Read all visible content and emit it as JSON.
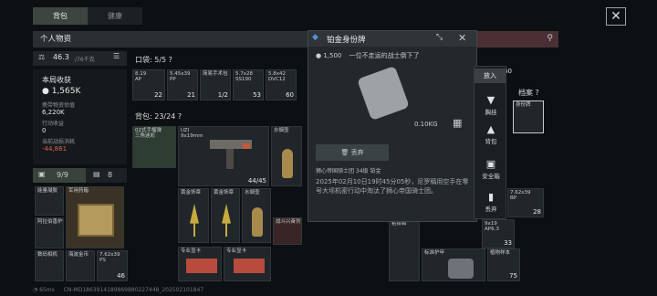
{
  "tabs": [
    "背包",
    "健康"
  ],
  "panel_title": "个人物资",
  "weight": {
    "value": "46.3",
    "max": "/76千克"
  },
  "stats": {
    "round_income_label": "本局收获",
    "round_income": "1,565K",
    "carried_value_label": "携带物资估值",
    "carried_value": "6,220K",
    "action_income_label": "行动收益",
    "action_income": "0",
    "action_cost_label": "当前战损消耗",
    "action_cost": "-44,861"
  },
  "pouch_tabs": {
    "a": "9/9",
    "b": "8"
  },
  "pocket": {
    "label": "口袋: 5/5",
    "items": [
      {
        "name": "8.19\nAP",
        "cnt": "22"
      },
      {
        "name": "5.45x39\nPP",
        "cnt": "21"
      },
      {
        "name": "简易手术包",
        "cnt": "1/2"
      },
      {
        "name": "5.7x28\nSS190",
        "cnt": "53"
      },
      {
        "name": "5.8x42\nDVC12",
        "cnt": "60"
      }
    ]
  },
  "backpack": {
    "label": "背包: 23/24"
  },
  "left_items": [
    {
      "name": "能量凝胶"
    },
    {
      "name": "军用药箱"
    },
    {
      "name": "阿拉伯香炉"
    },
    {
      "name": "数码相机"
    },
    {
      "name": "海波金币"
    },
    {
      "name": "7.62x39\nPS",
      "cnt": "46"
    }
  ],
  "bp_items": [
    {
      "name": "02式手榴弹\n三角迷彩"
    },
    {
      "name": "UZI\n9x19mm",
      "cnt": "44/45"
    },
    {
      "name": "水烟壶"
    },
    {
      "name": "黄金饰章"
    },
    {
      "name": "黄金饰章"
    },
    {
      "name": "水烟壶"
    },
    {
      "name": "战斗兴奋剂"
    },
    {
      "name": "专业显卡"
    },
    {
      "name": "专业显卡"
    }
  ],
  "detail": {
    "title": "铂金身份牌",
    "price": "1,500",
    "flavor": "一位不走运的战士倒下了",
    "weight": "0.10KG",
    "discard": "丢弃",
    "meta": "狮心帝国骑士团  34级  铂金",
    "desc": "2025年02月10日19时45分05秒，尼罗稱用空手在零号大坝机密行动中淘汰了狮心帝国骑士团。"
  },
  "side_menu": {
    "put_in": "放入",
    "chest": "胸挂",
    "bag": "背包",
    "safebox": "安全箱",
    "discard": "丢弃"
  },
  "archive": {
    "label": "档案",
    "item": "身份牌"
  },
  "right_items": [
    {
      "name": "7.62x39\nBP",
      "cnt": "28"
    },
    {
      "name": "9x19\nAP6.3",
      "cnt": "33"
    },
    {
      "name": "标准护甲"
    },
    {
      "name": "植物样本",
      "cnt": "75"
    },
    {
      "name": "粘钳钳"
    }
  ],
  "right_top_cnt": "60",
  "status": {
    "ping": "65ms",
    "uid": "CN-MD1863914189869880227448_202502101847"
  }
}
